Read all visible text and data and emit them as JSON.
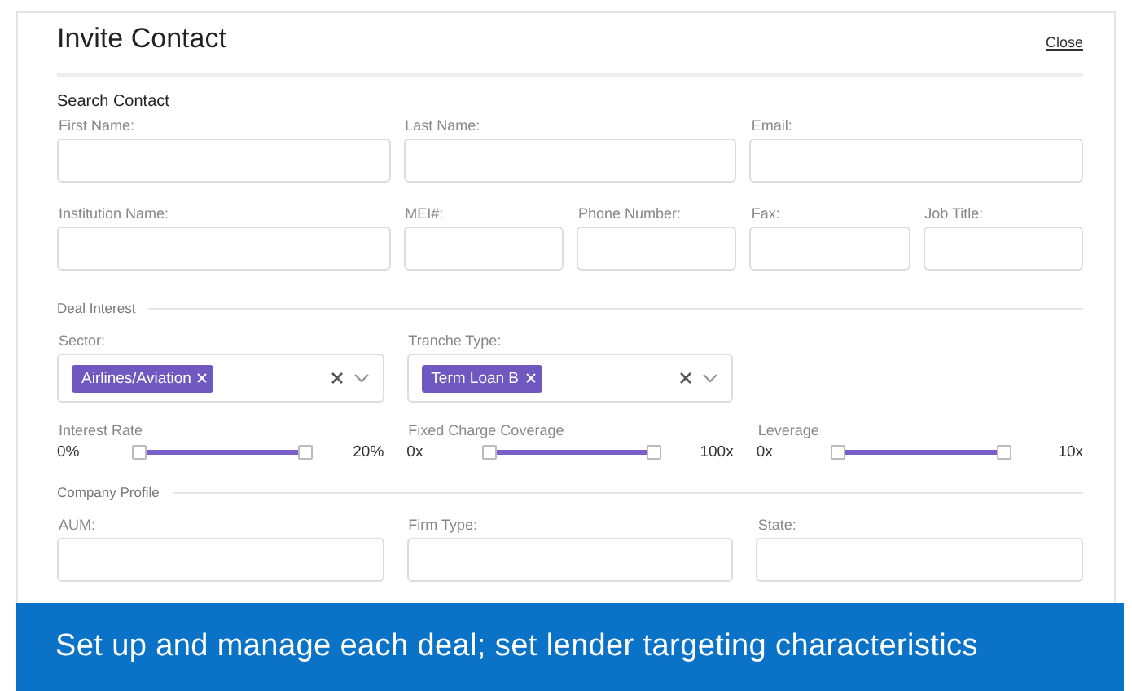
{
  "dialog": {
    "title": "Invite Contact",
    "close_link": "Close"
  },
  "search_contact": {
    "heading": "Search Contact",
    "fields": [
      {
        "label": "First Name:"
      },
      {
        "label": "Last Name:"
      },
      {
        "label": "Email:"
      },
      {
        "label": "Institution Name:"
      },
      {
        "label": "MEI#:"
      },
      {
        "label": "Phone Number:"
      },
      {
        "label": "Fax:"
      },
      {
        "label": "Job Title:"
      }
    ]
  },
  "deal_interest": {
    "heading": "Deal Interest",
    "selects": [
      {
        "label": "Sector:",
        "tags": [
          "Airlines/Aviation"
        ]
      },
      {
        "label": "Tranche Type:",
        "tags": [
          "Term Loan B"
        ]
      }
    ],
    "sliders": [
      {
        "label": "Interest Rate",
        "min": "0%",
        "max": "20%",
        "level": 1
      },
      {
        "label": "Fixed Charge Coverage",
        "min": "0x",
        "max": "100x",
        "level": 1
      },
      {
        "label": "Leverage",
        "min": "0x",
        "max": "10x",
        "level": 1
      }
    ]
  },
  "company_profile": {
    "heading": "Company Profile",
    "fields": [
      {
        "label": "AUM:"
      },
      {
        "label": "Firm Type:"
      },
      {
        "label": "State:"
      }
    ]
  },
  "caption_banner": "Set up and manage each deal; set lender targeting characteristics"
}
